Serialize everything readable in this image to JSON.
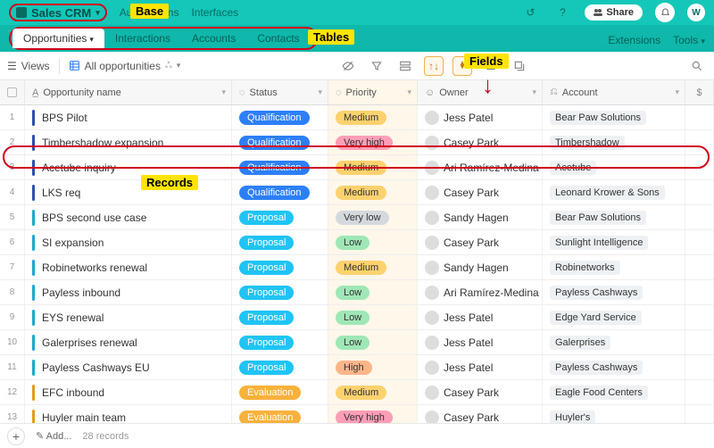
{
  "base": {
    "name": "Sales CRM"
  },
  "topnav": {
    "automations": "Automations",
    "interfaces": "Interfaces"
  },
  "share": "Share",
  "avatar_initial": "W",
  "tabs": [
    "Opportunities",
    "Interactions",
    "Accounts",
    "Contacts"
  ],
  "active_tab": 0,
  "right_tabs": {
    "extensions": "Extensions",
    "tools": "Tools"
  },
  "toolbar": {
    "views": "Views",
    "viewname": "All opportunities"
  },
  "columns": {
    "name": "Opportunity name",
    "status": "Status",
    "priority": "Priority",
    "owner": "Owner",
    "account": "Account"
  },
  "status_colors": {
    "Qualification": "#2d7ff9",
    "Proposal": "#20c4f4",
    "Evaluation": "#f8b13b"
  },
  "priority_colors": {
    "Medium": "#fdd26e",
    "Very high": "#ff9eb7",
    "Very low": "#d5d9de",
    "Low": "#9fe7b6",
    "High": "#ffb68a"
  },
  "bar_colors": {
    "Qualification": "#2d4db3",
    "Proposal": "#1aa8d0",
    "Evaluation": "#e79a1c"
  },
  "rows": [
    {
      "n": "1",
      "name": "BPS Pilot",
      "status": "Qualification",
      "priority": "Medium",
      "owner": "Jess Patel",
      "account": "Bear Paw Solutions"
    },
    {
      "n": "2",
      "name": "Timbershadow expansion",
      "status": "Qualification",
      "priority": "Very high",
      "owner": "Casey Park",
      "account": "Timbershadow"
    },
    {
      "n": "3",
      "name": "Acetube inquiry",
      "status": "Qualification",
      "priority": "Medium",
      "owner": "Ari Ramírez-Medina",
      "account": "Acetube"
    },
    {
      "n": "4",
      "name": "LKS req",
      "status": "Qualification",
      "priority": "Medium",
      "owner": "Casey Park",
      "account": "Leonard Krower & Sons"
    },
    {
      "n": "5",
      "name": "BPS second use case",
      "status": "Proposal",
      "priority": "Very low",
      "owner": "Sandy Hagen",
      "account": "Bear Paw Solutions"
    },
    {
      "n": "6",
      "name": "SI expansion",
      "status": "Proposal",
      "priority": "Low",
      "owner": "Casey Park",
      "account": "Sunlight Intelligence"
    },
    {
      "n": "7",
      "name": "Robinetworks renewal",
      "status": "Proposal",
      "priority": "Medium",
      "owner": "Sandy Hagen",
      "account": "Robinetworks"
    },
    {
      "n": "8",
      "name": "Payless inbound",
      "status": "Proposal",
      "priority": "Low",
      "owner": "Ari Ramírez-Medina",
      "account": "Payless Cashways"
    },
    {
      "n": "9",
      "name": "EYS renewal",
      "status": "Proposal",
      "priority": "Low",
      "owner": "Jess Patel",
      "account": "Edge Yard Service"
    },
    {
      "n": "10",
      "name": "Galerprises renewal",
      "status": "Proposal",
      "priority": "Low",
      "owner": "Jess Patel",
      "account": "Galerprises"
    },
    {
      "n": "11",
      "name": "Payless Cashways EU",
      "status": "Proposal",
      "priority": "High",
      "owner": "Jess Patel",
      "account": "Payless Cashways"
    },
    {
      "n": "12",
      "name": "EFC inbound",
      "status": "Evaluation",
      "priority": "Medium",
      "owner": "Casey Park",
      "account": "Eagle Food Centers"
    },
    {
      "n": "13",
      "name": "Huyler main team",
      "status": "Evaluation",
      "priority": "Very high",
      "owner": "Casey Park",
      "account": "Huyler's"
    }
  ],
  "footer": {
    "add": "Add...",
    "count": "28 records"
  },
  "annotations": {
    "base": "Base",
    "tables": "Tables",
    "fields": "Fields",
    "records": "Records"
  }
}
